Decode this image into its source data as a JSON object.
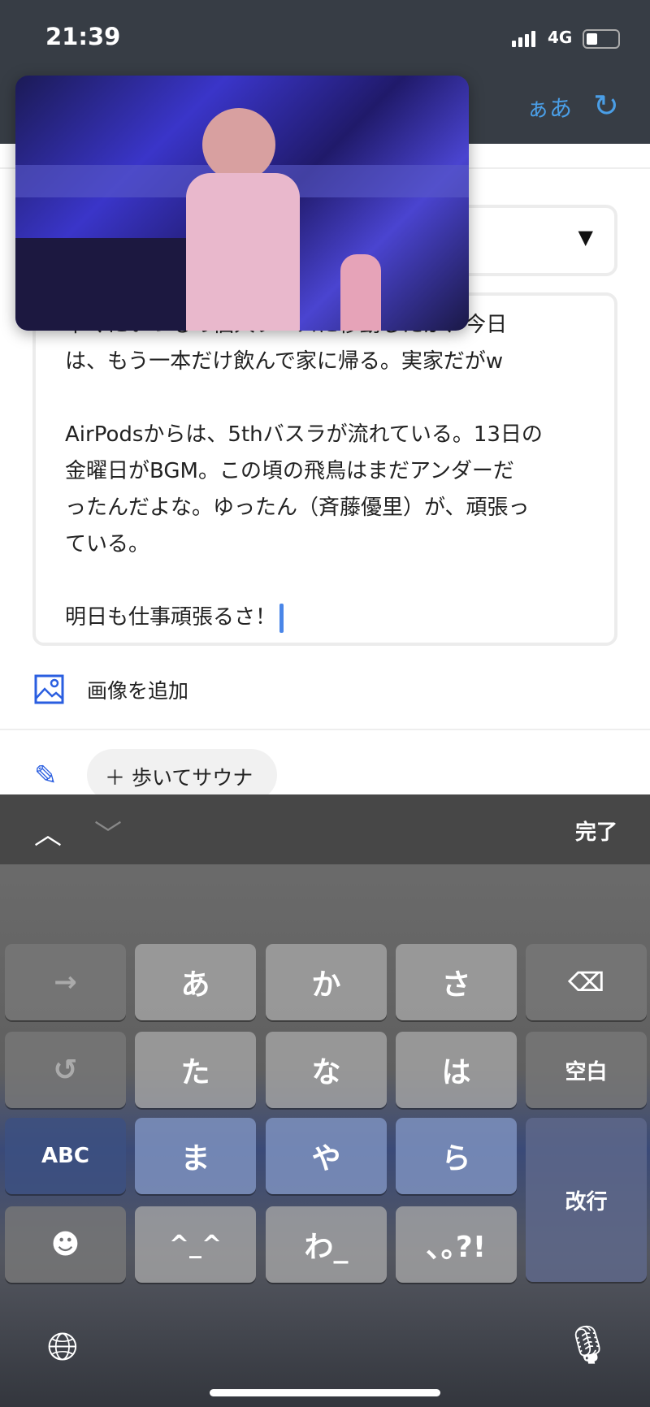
{
  "status_bar": {
    "time": "21:39",
    "network": "4G",
    "battery_level": 0.3
  },
  "header": {
    "kana_button": "ぁあ",
    "refresh_icon": "refresh-icon"
  },
  "editor": {
    "lines": [
      "早くにいつもの個人ブースに移動したが、今日",
      "は、もう一本だけ飲んで家に帰る。実家だがw",
      "",
      "AirPodsからは、5thバスラが流れている。13日の",
      "金曜日がBGM。この頃の飛鳥はまだアンダーだ",
      "ったんだよな。ゆったん（斉藤優里）が、頑張っ",
      "ている。",
      "",
      "明日も仕事頑張るさ！"
    ],
    "accent": "#4a86e8"
  },
  "add_image": {
    "label": "画像を追加"
  },
  "tag_chip": {
    "label": "＋ 歩いてサウナ"
  },
  "keyboard": {
    "done": "完了",
    "keys": [
      [
        "→",
        "あ",
        "か",
        "さ",
        "⌫"
      ],
      [
        "↺",
        "た",
        "な",
        "は",
        "空白"
      ],
      [
        "ABC",
        "ま",
        "や",
        "ら",
        "改行"
      ],
      [
        "☻",
        "^_^",
        "わ_",
        "､｡?!"
      ]
    ]
  }
}
